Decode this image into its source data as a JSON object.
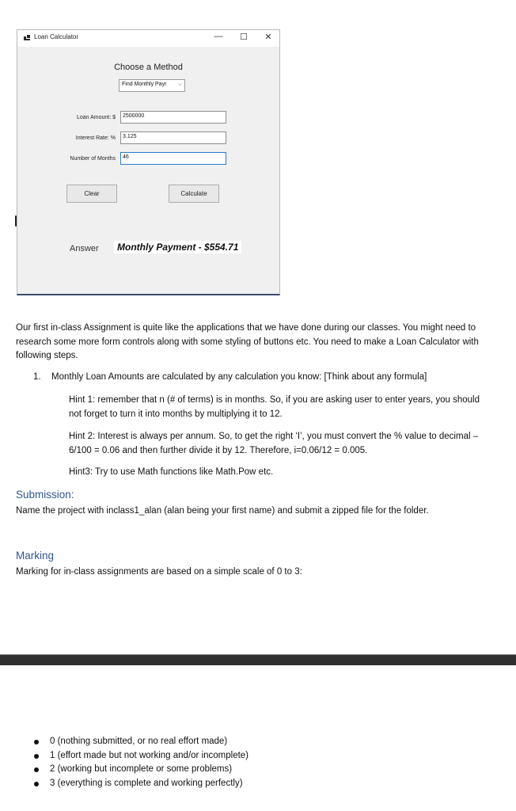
{
  "window": {
    "title": "Loan Calculator",
    "controls": {
      "minimize": "—",
      "maximize": "☐",
      "close": "✕"
    },
    "heading": "Choose a Method",
    "method_select": {
      "selected": "Find Monthly Payr",
      "chevron": "⌵"
    },
    "fields": [
      {
        "label": "Loan Amount: $",
        "value": "2500000"
      },
      {
        "label": "Interest Rate: %",
        "value": "3.125"
      },
      {
        "label": "Number of Months",
        "value": "46"
      }
    ],
    "buttons": {
      "clear": "Clear",
      "calculate": "Calculate"
    },
    "answer_label": "Answer",
    "answer_value": "Monthly Payment - $554.71"
  },
  "document": {
    "intro": "Our first in-class Assignment is quite like the applications that we have done during our classes. You might need to research some more form controls along with some styling of buttons etc. You need to make a Loan Calculator with following steps.",
    "steps": [
      {
        "num": "1.",
        "text": "Monthly Loan Amounts are calculated by any calculation you know: [Think about any formula]"
      }
    ],
    "hints": [
      "Hint 1: remember that n (# of terms) is in months. So, if you are asking user to enter years, you should not forget to turn it into months by multiplying it to 12.",
      "Hint 2: Interest is always per annum. So, to get the right ‘I’, you must convert the % value to decimal – 6/100 = 0.06 and then further divide it by 12. Therefore, i=0.06/12 = 0.005.",
      "Hint3: Try to use Math functions like Math.Pow etc."
    ],
    "submission_heading": "Submission:",
    "submission_text": "Name the project with inclass1_alan (alan being your first name) and submit a zipped file for the folder.",
    "marking_heading": "Marking",
    "marking_text": "Marking for in-class assignments are based on a simple scale of 0 to 3:",
    "marking_items": [
      "0 (nothing submitted, or no real effort made)",
      "1 (effort made but not working and/or incomplete)",
      "2 (working but incomplete or some problems)",
      "3 (everything is complete and working perfectly)"
    ]
  }
}
